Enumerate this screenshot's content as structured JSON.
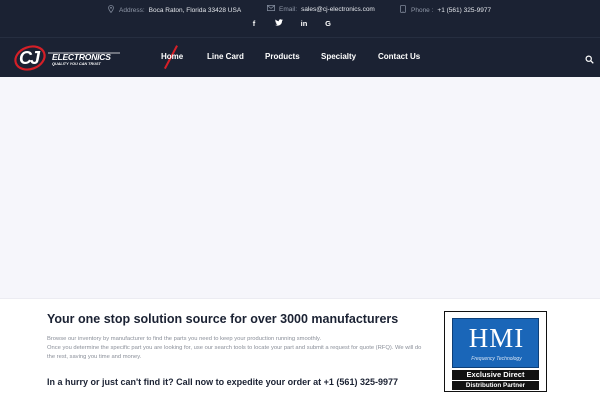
{
  "topbar": {
    "address": {
      "icon": "location-pin-icon",
      "label": "Address:",
      "value": "Boca Raton, Florida 33428 USA"
    },
    "email": {
      "icon": "envelope-icon",
      "label": "Email:",
      "value": "sales@cj-electronics.com"
    },
    "phone": {
      "icon": "phone-icon",
      "label": "Phone :",
      "value": "+1 (561) 325-9977"
    },
    "social": [
      {
        "name": "facebook-icon",
        "glyph": "f"
      },
      {
        "name": "twitter-icon",
        "glyph": "t"
      },
      {
        "name": "linkedin-icon",
        "glyph": "in"
      },
      {
        "name": "google-icon",
        "glyph": "G"
      }
    ]
  },
  "brand": {
    "logo_text": "ELECTRONICS",
    "tagline": "QUALITY YOU CAN TRUST",
    "accent_color": "#d51f27"
  },
  "nav": {
    "items": [
      {
        "label": "Home",
        "active": true
      },
      {
        "label": "Line Card",
        "active": false
      },
      {
        "label": "Products",
        "active": false
      },
      {
        "label": "Specialty",
        "active": false
      },
      {
        "label": "Contact Us",
        "active": false
      }
    ],
    "search_icon": "search-icon"
  },
  "main": {
    "headline": "Your one stop solution source for over 3000 manufacturers",
    "body": [
      "Browse our inventory by manufacturer to find the parts you need to keep your production running smoothly.",
      "Once you determine the specific part you are looking for, use our search tools to locate your part and submit a request for quote (RFQ). We will do the rest, saving you time and money."
    ],
    "cta": "In a hurry or just can't find it? Call now to expedite your order at +1 (561) 325-9977"
  },
  "badge": {
    "logo": "HMI",
    "logo_sub": "Frequency Technology",
    "line1": "Exclusive Direct",
    "line2": "Distribution Partner"
  },
  "colors": {
    "header_bg": "#1b2233",
    "hero_bg": "#f6f6fb",
    "text_dark": "#1b2233",
    "hmi_blue": "#1a66b8"
  }
}
